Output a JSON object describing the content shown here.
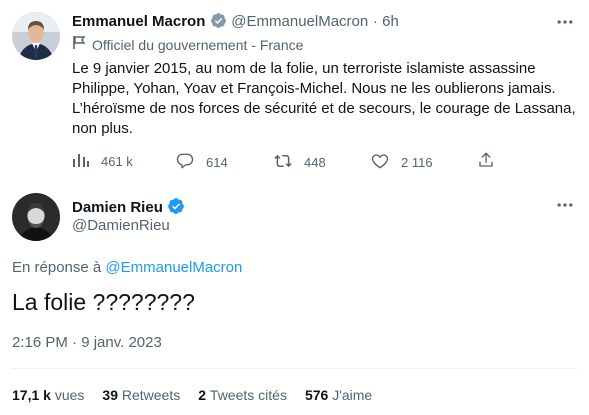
{
  "original_tweet": {
    "author_name": "Emmanuel Macron",
    "handle": "@EmmanuelMacron",
    "separator": "·",
    "time_ago": "6h",
    "label": "Officiel du gouvernement - France",
    "text_lines": [
      "Le 9 janvier 2015, au nom de la folie, un terroriste islamiste assassine",
      "Philippe, Yohan, Yoav et François-Michel. Nous ne les oublierons jamais.",
      "L’héroïsme de nos forces de sécurité et de secours, le courage de Lassana,",
      "non plus."
    ],
    "views": "461 k",
    "replies": "614",
    "retweets": "448",
    "likes": "2 116"
  },
  "reply_tweet": {
    "author_name": "Damien Rieu",
    "handle": "@DamienRieu",
    "reply_prefix": "En réponse à",
    "reply_to": "@EmmanuelMacron",
    "text": "La folie ????????",
    "timestamp": "2:16 PM · 9 janv. 2023",
    "stats": {
      "views_count": "17,1 k",
      "views_label": "vues",
      "retweets_count": "39",
      "retweets_label": "Retweets",
      "quotes_count": "2",
      "quotes_label": "Tweets cités",
      "likes_count": "576",
      "likes_label": "J'aime"
    }
  },
  "colors": {
    "accent": "#1d9bf0",
    "muted": "#536471",
    "divider": "#eff3f4"
  }
}
